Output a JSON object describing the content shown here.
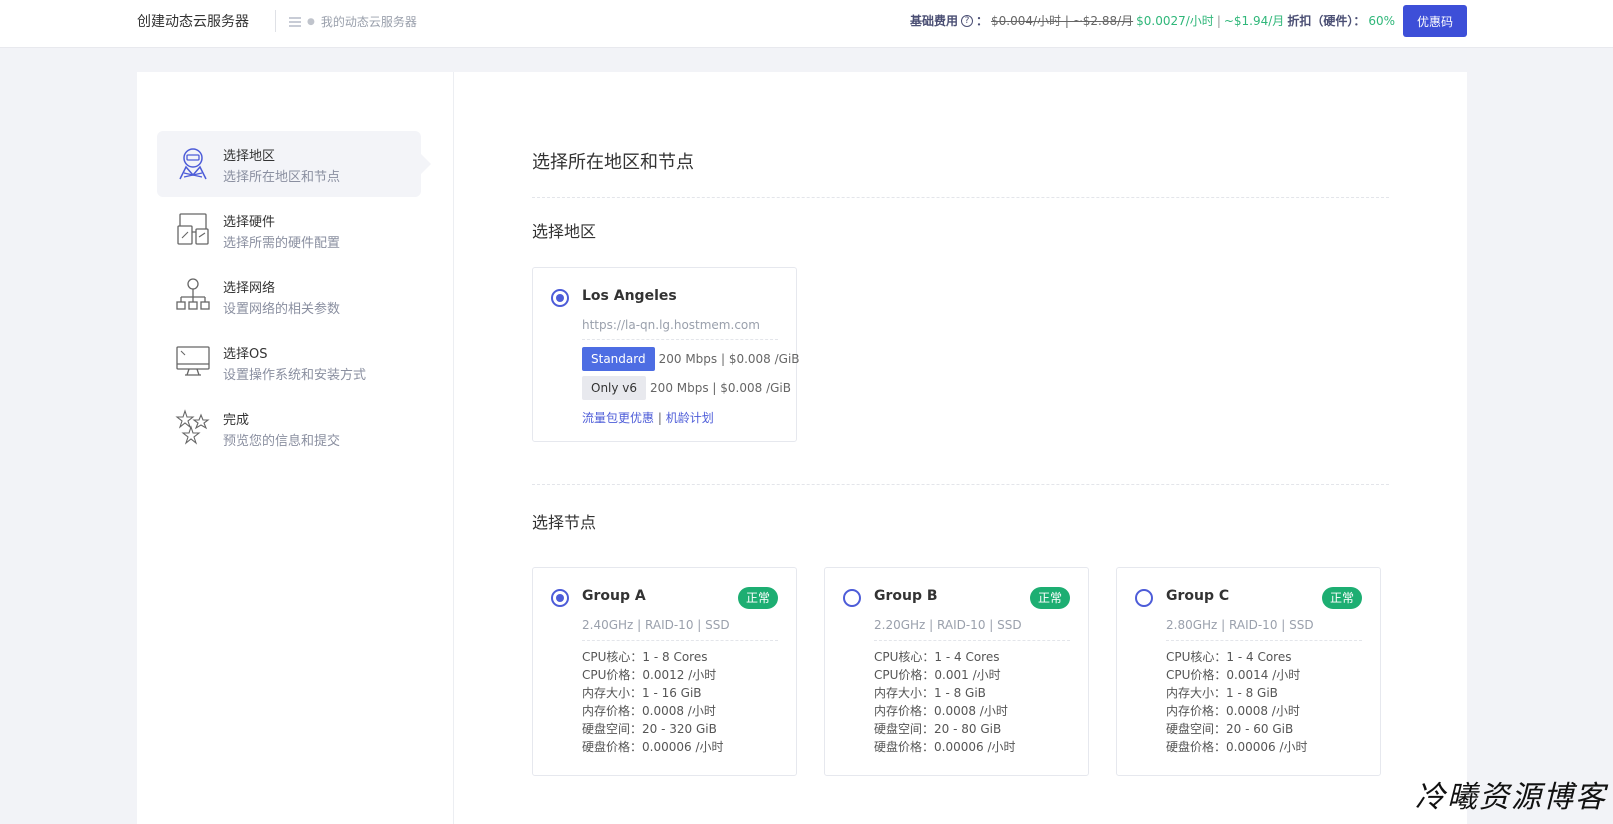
{
  "header": {
    "app_title": "创建动态云服务器",
    "breadcrumb": "我的动态云服务器",
    "price_label": "基础费用",
    "old_price": "$0.004/小时 | ~$2.88/月",
    "new_price_hour": "$0.0027/小时",
    "new_price_month": "~$1.94/月",
    "discount_label": "折扣（硬件）：",
    "discount_value": "60%",
    "coupon_button": "优惠码"
  },
  "steps": [
    {
      "title": "选择地区",
      "subtitle": "选择所在地区和节点",
      "icon": "ninja-icon",
      "active": true
    },
    {
      "title": "选择硬件",
      "subtitle": "选择所需的硬件配置",
      "icon": "hardware-icon",
      "active": false
    },
    {
      "title": "选择网络",
      "subtitle": "设置网络的相关参数",
      "icon": "network-icon",
      "active": false
    },
    {
      "title": "选择OS",
      "subtitle": "设置操作系统和安装方式",
      "icon": "monitor-icon",
      "active": false
    },
    {
      "title": "完成",
      "subtitle": "预览您的信息和提交",
      "icon": "stars-icon",
      "active": false
    }
  ],
  "main": {
    "heading": "选择所在地区和节点",
    "region_heading": "选择地区",
    "node_heading": "选择节点"
  },
  "region": {
    "name": "Los Angeles",
    "url": "https://la-qn.lg.hostmem.com",
    "selected": true,
    "networks": [
      {
        "badge": "Standard",
        "detail": "200 Mbps | $0.008 /GiB"
      },
      {
        "badge": "Only v6",
        "detail": "200 Mbps | $0.008 /GiB"
      }
    ],
    "link1": "流量包更优惠",
    "link_sep": "|",
    "link2": "机龄计划"
  },
  "nodes": [
    {
      "name": "Group A",
      "status": "正常",
      "selected": true,
      "meta": "2.40GHz | RAID-10 | SSD",
      "specs": [
        "CPU核心：1 - 8 Cores",
        "CPU价格：0.0012 /小时",
        "内存大小：1 - 16 GiB",
        "内存价格：0.0008 /小时",
        "硬盘空间：20 - 320 GiB",
        "硬盘价格：0.00006 /小时"
      ]
    },
    {
      "name": "Group B",
      "status": "正常",
      "selected": false,
      "meta": "2.20GHz | RAID-10 | SSD",
      "specs": [
        "CPU核心：1 - 4 Cores",
        "CPU价格：0.001 /小时",
        "内存大小：1 - 8 GiB",
        "内存价格：0.0008 /小时",
        "硬盘空间：20 - 80 GiB",
        "硬盘价格：0.00006 /小时"
      ]
    },
    {
      "name": "Group C",
      "status": "正常",
      "selected": false,
      "meta": "2.80GHz | RAID-10 | SSD",
      "specs": [
        "CPU核心：1 - 4 Cores",
        "CPU价格：0.0014 /小时",
        "内存大小：1 - 8 GiB",
        "内存价格：0.0008 /小时",
        "硬盘空间：20 - 60 GiB",
        "硬盘价格：0.00006 /小时"
      ]
    }
  ],
  "watermark": "冷曦资源博客",
  "colors": {
    "accent": "#3d4fd8",
    "success": "#1dae72",
    "price_green": "#30b77a"
  }
}
